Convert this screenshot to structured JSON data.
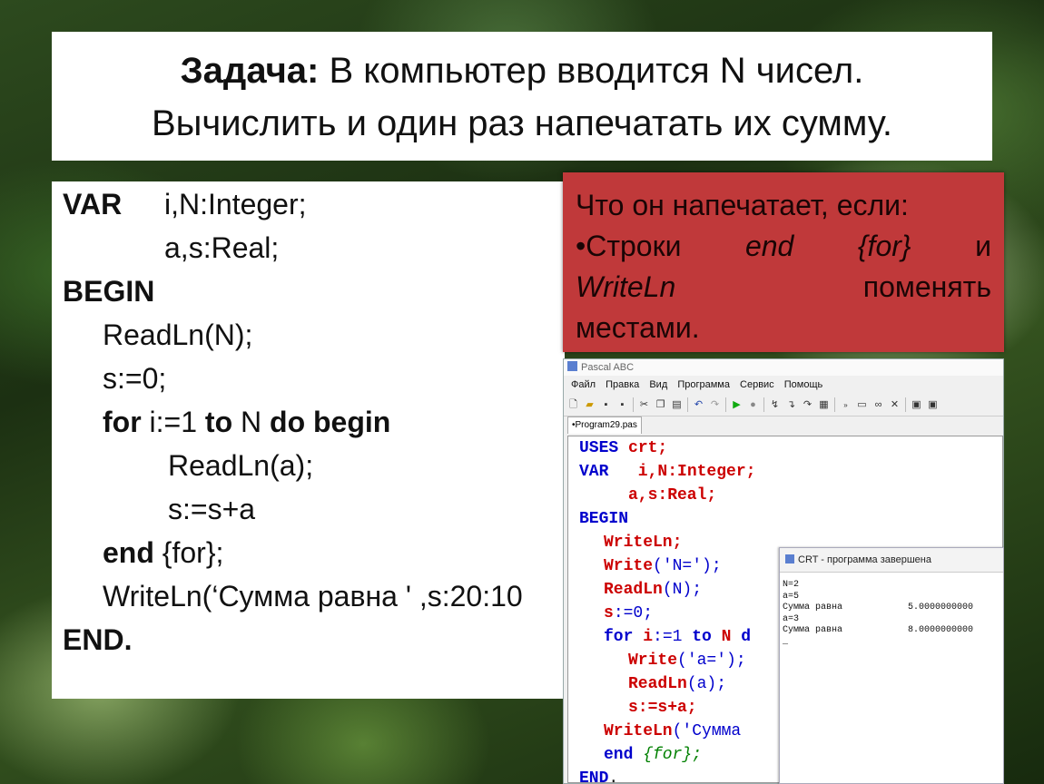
{
  "title": {
    "bold_part": "Задача:",
    "line1_rest": " В компьютер вводится N чисел.",
    "line2": "Вычислить и один раз напечатать их сумму."
  },
  "code": {
    "l1_kw": "VAR",
    "l1_rest": "i,N:Integer;",
    "l2": "a,s:Real;",
    "l3_kw": "BEGIN",
    "l4": "ReadLn(N);",
    "l5": "s:=0;",
    "l6_for": "for",
    "l6_a": " i:=1 ",
    "l6_to": "to",
    "l6_b": " N ",
    "l6_do": "do begin",
    "l7": "ReadLn(a);",
    "l8": "s:=s+a",
    "l9_kw": "end",
    "l9_rest": " {for};",
    "l10": "WriteLn(‘Сумма равна ' ,s:20:10",
    "l11_kw": "END."
  },
  "note": {
    "line1": "Что он напечатает, если:",
    "l2_a": "•Строки",
    "l2_b": "end",
    "l2_c": "{for}",
    "l2_d": "и",
    "l3_a": "WriteLn",
    "l3_b": "поменять",
    "line4": "местами."
  },
  "ide": {
    "title": "Pascal ABC",
    "menu": [
      "Файл",
      "Правка",
      "Вид",
      "Программа",
      "Сервис",
      "Помощь"
    ],
    "tab": "•Program29.pas",
    "code": {
      "uses": "USES",
      "crt": " crt;",
      "var": "VAR",
      "l2_rest": "   i,N:Integer;",
      "l3": "a,s:Real;",
      "begin": "BEGIN",
      "writeln": "WriteLn;",
      "write1": "Write",
      "write1_arg": "('N=');",
      "readln_n": "ReadLn",
      "readln_n_arg": "(N);",
      "s0_s": "s",
      "s0_rest": ":=0;",
      "for": "for",
      "for_i": " i",
      "for_assign": ":=1 ",
      "to": "to",
      "for_n": " N ",
      "do": "d",
      "write2": "Write",
      "write2_arg": "('a=');",
      "readln_a": "ReadLn",
      "readln_a_arg": "(a);",
      "ssa": "s:=s+a;",
      "writeln2": "WriteLn",
      "writeln2_arg": "('Сумма",
      "end": "end",
      "end_cmt": " {for};",
      "end_final": "END",
      "end_dot": "."
    }
  },
  "crt": {
    "title": "CRT - программа завершена",
    "output": "N=2\na=5\nСумма равна            5.0000000000\na=3\nСумма равна            8.0000000000\n_"
  }
}
